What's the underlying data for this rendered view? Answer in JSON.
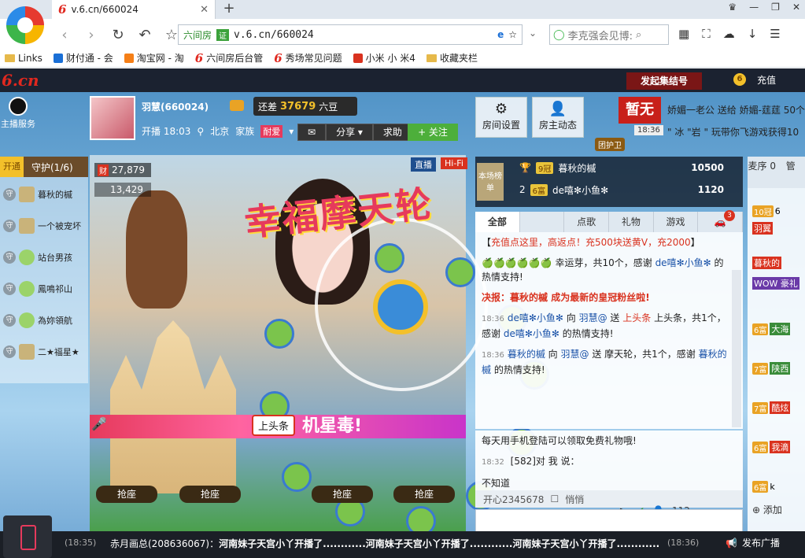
{
  "browser": {
    "tab_title": "v.6.cn/660024",
    "url": "v.6.cn/660024",
    "site_label": "六间房",
    "cert_label": "证",
    "search_placeholder": "李克强会见博:",
    "bookmarks": [
      "Links",
      "财付通 - 会",
      "淘宝网 - 淘",
      "六间房后台管",
      "秀场常见问题",
      "小米 小 米4",
      "收藏夹栏"
    ]
  },
  "header": {
    "logo": "6.cn",
    "gather_button": "发起集结号",
    "recharge": "充值",
    "qq_service": "主播服务"
  },
  "host": {
    "name": "羽慧(660024)",
    "beans_prefix": "还差",
    "beans_value": "37679",
    "beans_suffix": "六豆",
    "start_time": "开播 18:03",
    "location": "北京",
    "family_label": "家族",
    "family_badge": "耐爱",
    "share": "分享",
    "help": "求助",
    "follow": "+ 关注"
  },
  "room_buttons": {
    "settings": "房间设置",
    "host_news": "房主动态"
  },
  "ticker": {
    "pause": "暂无",
    "line1": "娇媚一老公 送给 娇媚-莛莛 50个",
    "line2": "\" 冰 \"岩 \" 玩带你飞游戏获得10",
    "time": "18:36",
    "guard_badge": "团护卫"
  },
  "guard": {
    "open": "开通",
    "title": "守护(1/6)",
    "items": [
      "暮秋的槭",
      "一个被宠坏",
      "站台男孩",
      "鳳鳴祁山",
      "為妳領航",
      "二★福星★"
    ]
  },
  "video": {
    "wealth": "27,879",
    "wealth_tag": "财",
    "fans": "13,429",
    "live_tag": "直播",
    "hifi_tag": "Hi-Fi",
    "fortune_text": "幸福摩天轮",
    "headline": "上头条",
    "banner": "机星毒!",
    "seat_label": "抢座"
  },
  "rank": {
    "icon_label": "本场榜单",
    "rows": [
      {
        "rank": "1",
        "level": "9冠",
        "name": "暮秋的槭",
        "coins": "10500"
      },
      {
        "rank": "2",
        "level": "6富",
        "name": "de嘻✻小鱼✻",
        "coins": "1120"
      }
    ]
  },
  "chat": {
    "tabs": [
      "全部",
      "",
      "点歌",
      "礼物",
      "游戏",
      "🚗"
    ],
    "car_badge": "3",
    "messages": [
      {
        "time": "",
        "parts": [
          "【",
          "充值点这里，高返点！充500块送黄V，充2000",
          "】"
        ]
      },
      {
        "time": "",
        "parts": [
          "🍏🍏🍏🍏🍏🍏 幸运芽，共10个，感谢 ",
          "de嘻✻小鱼✻",
          " 的热情支持!"
        ]
      },
      {
        "time": "",
        "parts": [
          "决报：",
          "暮秋的槭",
          " 成为最新的皇冠粉丝啦!"
        ]
      },
      {
        "time": "18:36",
        "parts": [
          "de嘻✻小鱼✻",
          " 向 ",
          "羽慧@",
          " 送 ",
          "上头条",
          " 上头条，共1个，感谢 ",
          "de嘻✻小鱼✻",
          " 的热情支持!"
        ]
      },
      {
        "time": "18:36",
        "parts": [
          "暮秋的槭",
          " 向 ",
          "羽慧@",
          " 送 ",
          "摩天轮",
          "，共1个，感谢 ",
          "暮秋的槭",
          " 的热情支持!"
        ]
      }
    ],
    "notice": "每天用手机登陆可以领取免费礼物哦!",
    "msg2_time": "18:32",
    "msg2_text": "[582]对 我 说：",
    "msg2_body": "不知道",
    "user_id": "开心2345678",
    "private": "悄悄",
    "count": "112",
    "add": "添加"
  },
  "userlist": {
    "tab1": "麦序 0",
    "tab2": "管",
    "rows": [
      {
        "lv": "10冠",
        "name": "6"
      },
      {
        "lv": "",
        "name": "羽翼"
      },
      {
        "lv": "",
        "name": "暮秋的"
      },
      {
        "lv": "",
        "name": "WOW 豪礼"
      },
      {
        "lv": "6富",
        "name": "大海"
      },
      {
        "lv": "7富",
        "name": "陕西"
      },
      {
        "lv": "7富",
        "name": "酷炫"
      },
      {
        "lv": "6富",
        "name": "我滴"
      },
      {
        "lv": "6富",
        "name": "k"
      }
    ]
  },
  "broadcast": {
    "time1": "(18:35)",
    "sender": "赤月画总(208636067)：",
    "message": "河南妹子天宫小丫开播了............河南妹子天宫小丫开播了............河南妹子天宫小丫开播了............",
    "time2": "(18:36)",
    "button": "发布广播"
  }
}
